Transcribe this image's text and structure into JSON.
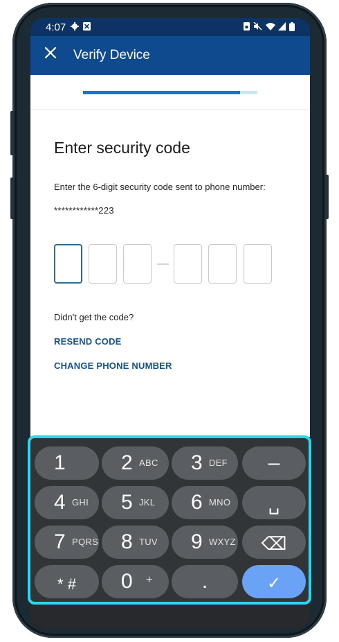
{
  "status_bar": {
    "time": "4:07",
    "left_icons": [
      "gear-icon",
      "notification-icon"
    ],
    "right_icons": [
      "sim-icon",
      "mute-icon",
      "wifi-icon",
      "signal-icon",
      "battery-icon"
    ]
  },
  "app_bar": {
    "close_icon": "close-icon",
    "title": "Verify Device"
  },
  "progress": {
    "fraction": 0.9
  },
  "page": {
    "heading": "Enter security code",
    "instruction": "Enter the 6-digit security code sent to phone number:",
    "phone_number": "************223",
    "code_digits": [
      "",
      "",
      "",
      "",
      "",
      ""
    ],
    "didnt_get": "Didn't get the code?",
    "resend": "RESEND CODE",
    "change_phone": "CHANGE PHONE NUMBER"
  },
  "keyboard": {
    "keys": [
      {
        "name": "key-1",
        "main": "1",
        "sub": ""
      },
      {
        "name": "key-2",
        "main": "2",
        "sub": "ABC"
      },
      {
        "name": "key-3",
        "main": "3",
        "sub": "DEF"
      },
      {
        "name": "key-minus",
        "main": "–",
        "sub": ""
      },
      {
        "name": "key-4",
        "main": "4",
        "sub": "GHI"
      },
      {
        "name": "key-5",
        "main": "5",
        "sub": "JKL"
      },
      {
        "name": "key-6",
        "main": "6",
        "sub": "MNO"
      },
      {
        "name": "key-space",
        "main": "␣",
        "sub": ""
      },
      {
        "name": "key-7",
        "main": "7",
        "sub": "PQRS"
      },
      {
        "name": "key-8",
        "main": "8",
        "sub": "TUV"
      },
      {
        "name": "key-9",
        "main": "9",
        "sub": "WXYZ"
      },
      {
        "name": "key-backspace",
        "main": "⌫",
        "sub": ""
      },
      {
        "name": "key-star-hash",
        "main": "* #",
        "sub": ""
      },
      {
        "name": "key-0",
        "main": "0",
        "sub": "+"
      },
      {
        "name": "key-period",
        "main": ".",
        "sub": ""
      },
      {
        "name": "key-enter",
        "main": "✓",
        "sub": ""
      }
    ],
    "outline_color": "#2ad7ee",
    "enter_color": "#6aa2f5"
  },
  "colors": {
    "status_bar": "#0d3264",
    "app_bar": "#104a8e",
    "link": "#135190",
    "progress": "#1976c6"
  }
}
